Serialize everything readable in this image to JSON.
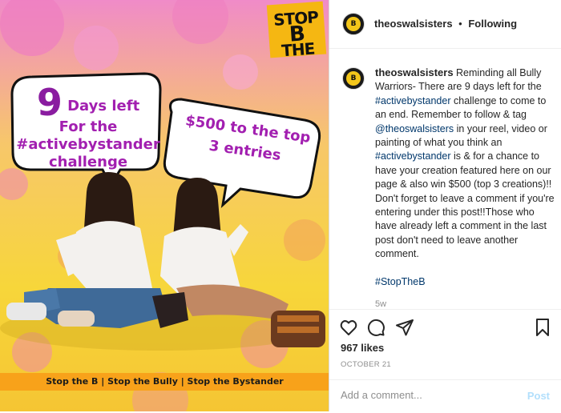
{
  "media": {
    "logo_line1": "STOP",
    "logo_line2": "THE",
    "logo_letter": "B",
    "bubble1_number": "9",
    "bubble1_line1": "Days left",
    "bubble1_line2": "For the",
    "bubble1_line3": "#activebystander",
    "bubble1_line4": "challenge",
    "bubble2_line1": "$500 to the top",
    "bubble2_line2": "3 entries",
    "banner": "Stop the B | Stop the Bully | Stop the Bystander"
  },
  "header": {
    "username": "theoswalsisters",
    "separator": "•",
    "follow_status": "Following"
  },
  "caption": {
    "username": "theoswalsisters",
    "text1": " Reminding all Bully Warriors- There are 9 days left for the ",
    "tag1": "#activebystander",
    "text2": " challenge to come to an end. Remember to follow & tag ",
    "tag2": "@theoswalsisters",
    "text3": " in your reel, video or painting of what you think an ",
    "tag3": "#activebystander",
    "text4": " is & for a chance to have your creation featured here on our page & also win $500 (top 3 creations)!!",
    "text5": "Don't forget to leave a comment if you're entering under this post!!Those who have already left a comment in the last post don't need to leave another comment.",
    "tag4": "#StopTheB",
    "time": "5w"
  },
  "actions": {
    "likes": "967 likes",
    "date": "OCTOBER 21",
    "comment_placeholder": "Add a comment...",
    "post_label": "Post"
  },
  "icons": {
    "like": "heart-icon",
    "comment": "comment-icon",
    "share": "share-icon",
    "save": "bookmark-icon"
  },
  "colors": {
    "tag": "#00376b",
    "post_disabled": "#b2dffc",
    "banner": "#f8a21a"
  }
}
